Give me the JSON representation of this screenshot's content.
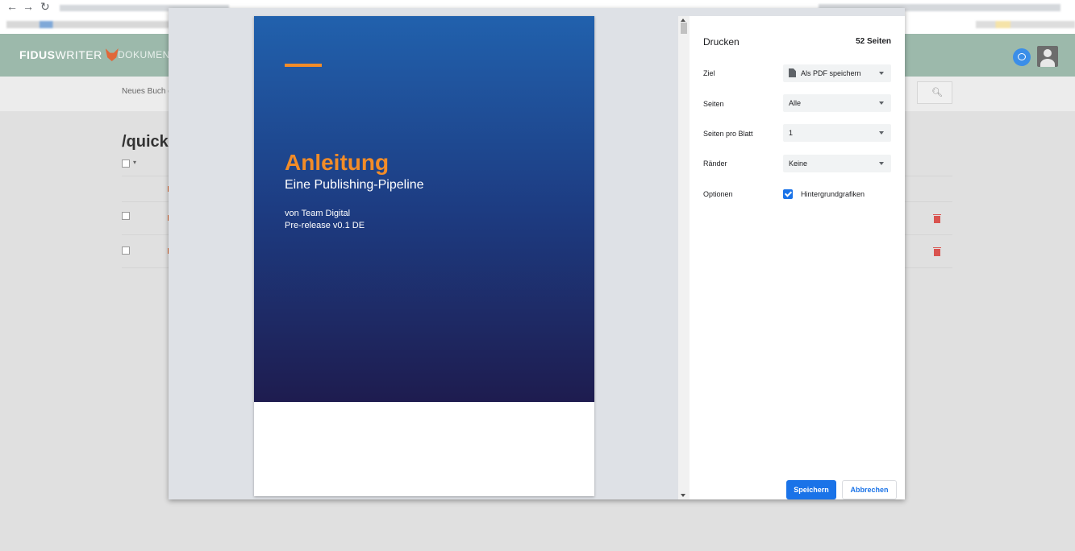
{
  "app": {
    "logo_bold": "FIDUS",
    "logo_light": "WRITER",
    "nav_label": "DOKUMENT",
    "new_book_label": "Neues Buch e",
    "doc_title": "/quick s"
  },
  "print_dialog": {
    "title": "Drucken",
    "page_count": "52 Seiten",
    "settings": {
      "destination_label": "Ziel",
      "destination_value": "Als PDF speichern",
      "pages_label": "Seiten",
      "pages_value": "Alle",
      "pages_per_sheet_label": "Seiten pro Blatt",
      "pages_per_sheet_value": "1",
      "margins_label": "Ränder",
      "margins_value": "Keine",
      "options_label": "Optionen",
      "background_graphics_label": "Hintergrundgrafiken",
      "background_graphics_checked": true
    },
    "save_label": "Speichern",
    "cancel_label": "Abbrechen",
    "preview": {
      "title": "Anleitung",
      "subtitle": "Eine Publishing-Pipeline",
      "author": "von Team Digital",
      "release": "Pre-release v0.1 DE"
    }
  },
  "colors": {
    "accent_orange": "#f28c28",
    "cover_blue_top": "#2161ad",
    "cover_blue_bottom": "#1e1c4f",
    "primary_blue": "#1a73e8",
    "app_header": "#9cb9ab"
  },
  "icons": {
    "chat": "chat-icon",
    "avatar": "user-avatar",
    "search": "search-icon",
    "trash": "trash-icon",
    "document": "document-icon",
    "checkbox": "checkbox-checked-icon"
  }
}
